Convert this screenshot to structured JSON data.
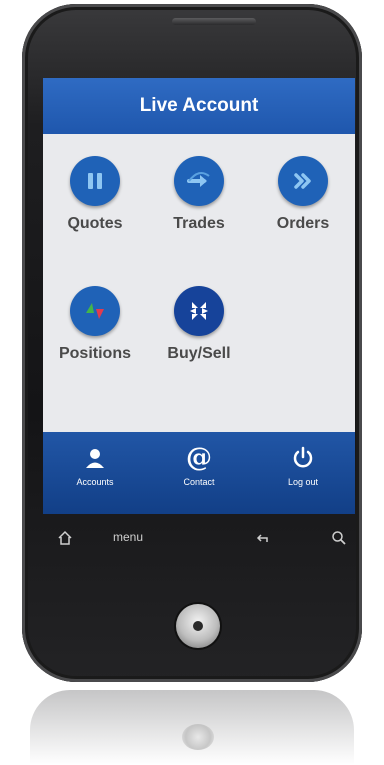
{
  "header": {
    "title": "Live Account"
  },
  "tiles": [
    {
      "label": "Quotes",
      "icon": "pause-icon",
      "color": "#1f62b7"
    },
    {
      "label": "Trades",
      "icon": "arrow-right-icon",
      "color": "#1f62b7"
    },
    {
      "label": "Orders",
      "icon": "double-chevron-right-icon",
      "color": "#1f62b7"
    },
    {
      "label": "Positions",
      "icon": "triangles-icon",
      "color": "#1f62b7"
    },
    {
      "label": "Buy/Sell",
      "icon": "bank-logo-icon",
      "color": "#16439a"
    }
  ],
  "bottom_nav": [
    {
      "label": "Accounts",
      "icon": "person-icon"
    },
    {
      "label": "Contact",
      "icon": "at-icon"
    },
    {
      "label": "Log out",
      "icon": "power-icon"
    }
  ],
  "soft_keys": {
    "menu_label": "menu"
  },
  "colors": {
    "primary": "#1f57ad",
    "screen_bg": "#e9eaed",
    "label": "#4a4a4a"
  }
}
